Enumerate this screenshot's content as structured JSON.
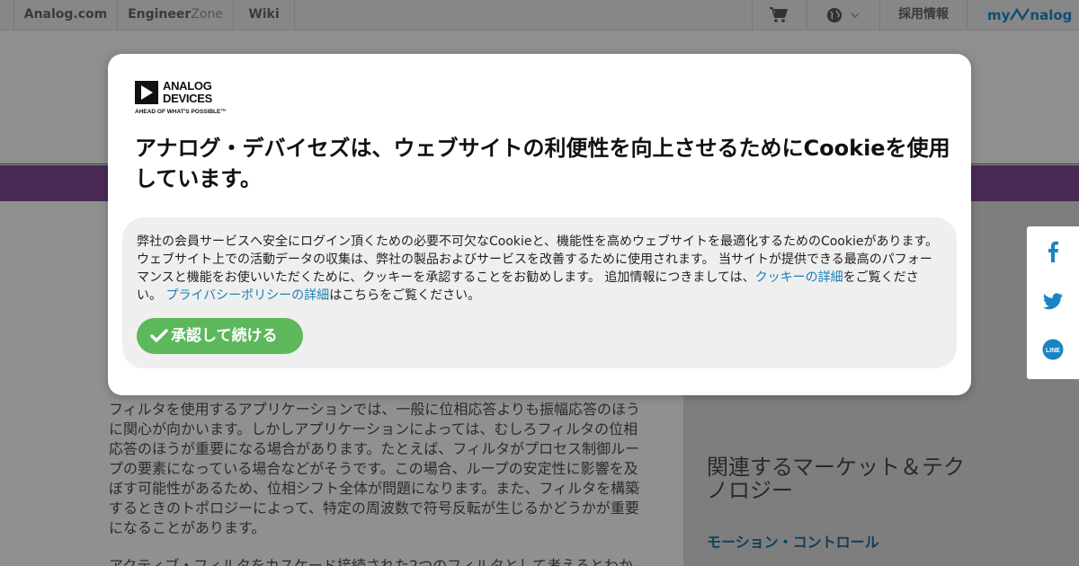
{
  "topbar": {
    "links": [
      "Analog.com",
      "Engineer",
      "Zone",
      "Wiki"
    ],
    "careers": "採用情報",
    "mylogo_prefix": "my",
    "mylogo_suffix": "nalog"
  },
  "article": {
    "p1": "フィルタを使用するアプリケーションでは、一般に位相応答よりも振幅応答のほうに関心が向かいます。しかしアプリケーションによっては、むしろフィルタの位相応答のほうが重要になる場合があります。たとえば、フィルタがプロセス制御ループの要素になっている場合などがそうです。この場合、ループの安定性に影響を及ぼす可能性があるため、位相シフト全体が問題になります。また、フィルタを構築するときのトポロジーによって、特定の周波数で符号反転が生じるかどうかが重要になることがあります。",
    "p2": "アクティブ・フィルタをカスケード接続された2つのフィルタとして考えるとわか"
  },
  "sidebar": {
    "heading": "関連するマーケット＆テクノロジー",
    "link": "モーション・コントロール"
  },
  "share": [
    "facebook-icon",
    "twitter-icon",
    "line-icon"
  ],
  "modal": {
    "logo_line1": "ANALOG",
    "logo_line2": "DEVICES",
    "logo_tagline": "AHEAD OF WHAT'S POSSIBLE™",
    "title": "アナログ・デバイセズは、ウェブサイトの利便性を向上させるためにCookieを使用しています。",
    "body_part1": "弊社の会員サービスへ安全にログイン頂くための必要不可欠なCookieと、機能性を高めウェブサイトを最適化するためのCookieがあります。 ウェブサイト上での活動データの収集は、弊社の製品およびサービスを改善するために使用されます。 当サイトが提供できる最高のパフォーマンスと機能をお使いいただくために、クッキーを承認することをお勧めします。 追加情報につきましては、",
    "cookie_link": "クッキーの詳細",
    "body_part2": "をご覧ください。 ",
    "privacy_link": "プライバシーポリシーの詳細",
    "body_part3": "はこちらをご覧ください。",
    "accept_label": "承認して続ける"
  },
  "colors": {
    "accept": "#5db85c",
    "link": "#1b7fb6",
    "purple_band": "#4a2a55",
    "overlay_gray": "#8f8f8f"
  }
}
